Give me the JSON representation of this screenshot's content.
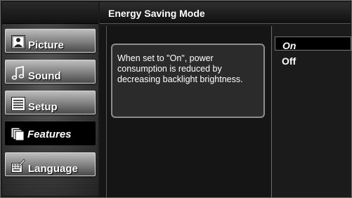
{
  "header": {
    "title": "Energy Saving Mode"
  },
  "sidebar": {
    "items": [
      {
        "label": "Picture",
        "icon": "picture-person-icon",
        "active": false
      },
      {
        "label": "Sound",
        "icon": "music-note-icon",
        "active": false
      },
      {
        "label": "Setup",
        "icon": "setup-list-icon",
        "active": false
      },
      {
        "label": "Features",
        "icon": "features-pages-icon",
        "active": true
      },
      {
        "label": "Language",
        "icon": "language-keyboard-pen-icon",
        "active": false
      }
    ]
  },
  "description": "When set to \"On\", power consumption is reduced by decreasing backlight brightness.",
  "options": [
    {
      "label": "On",
      "selected": true
    },
    {
      "label": "Off",
      "selected": false
    }
  ],
  "colors": {
    "background": "#1b1b1b",
    "button_face": "#8a8a8a",
    "text": "#ffffff"
  }
}
